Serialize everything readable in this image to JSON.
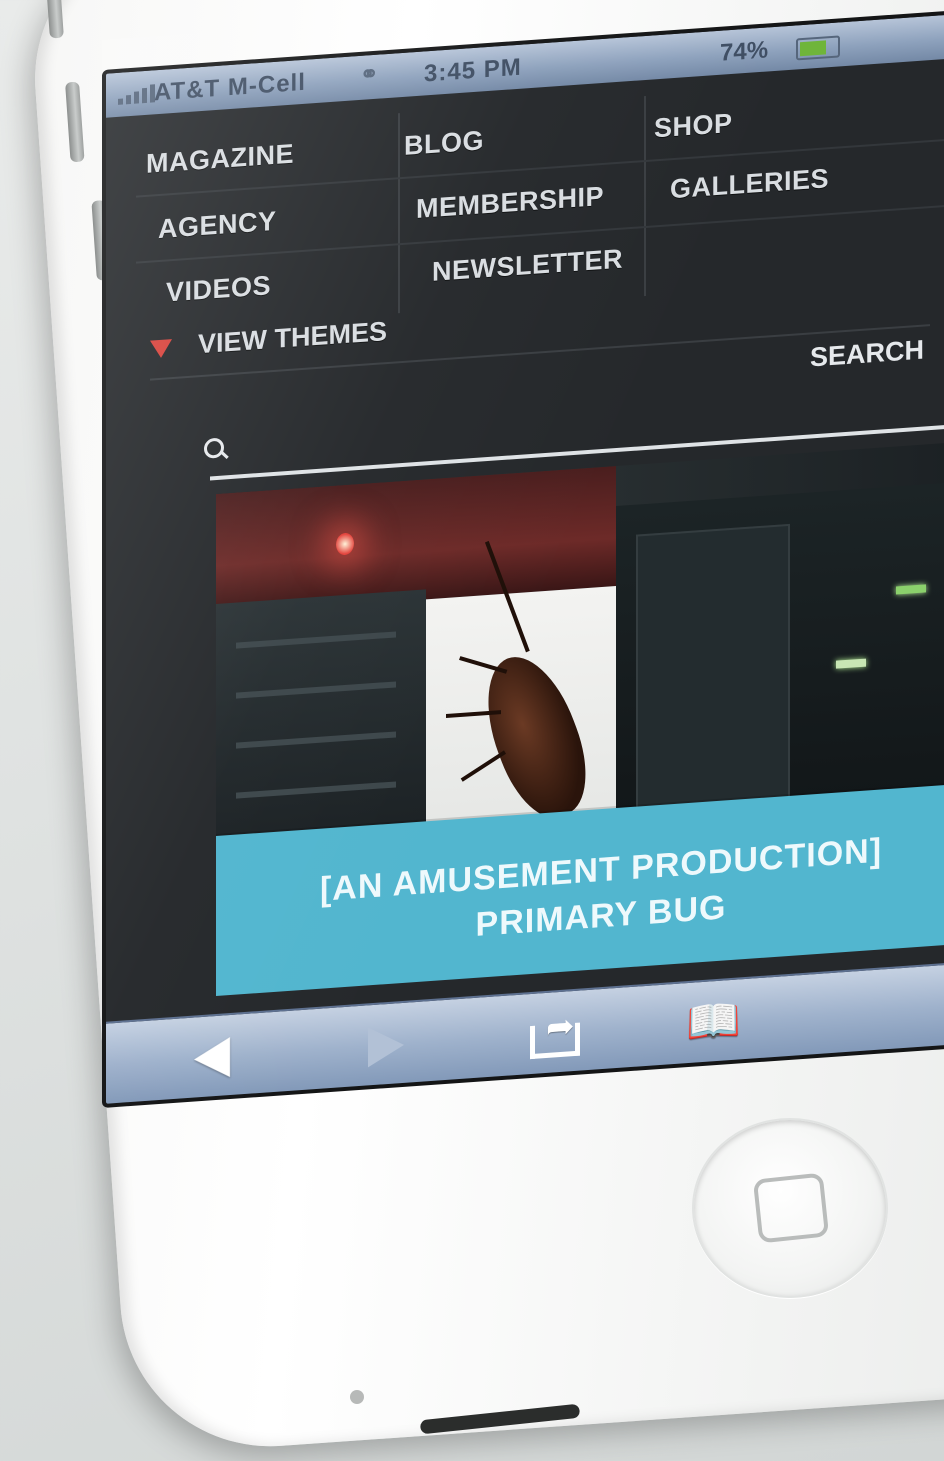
{
  "status_bar": {
    "carrier": "AT&T M-Cell",
    "time": "3:45 PM",
    "battery_percent": "74%"
  },
  "nav": {
    "col1": [
      "MAGAZINE",
      "AGENCY",
      "VIDEOS"
    ],
    "col2": [
      "BLOG",
      "MEMBERSHIP",
      "NEWSLETTER"
    ],
    "col3": [
      "SHOP",
      "GALLERIES"
    ]
  },
  "themes": {
    "label": "VIEW THEMES"
  },
  "search": {
    "label": "SEARCH",
    "value": ""
  },
  "hero": {
    "caption_line1": "[AN AMUSEMENT PRODUCTION]",
    "caption_line2": "PRIMARY BUG"
  },
  "toolbar": {
    "icons": [
      "back-icon",
      "forward-icon",
      "share-icon",
      "bookmarks-icon"
    ]
  },
  "colors": {
    "screen_bg": "#25282b",
    "caption_bg": "#52b6cf",
    "themes_arrow": "#d9433c",
    "toolbar_bg": "#9fb2cc"
  }
}
